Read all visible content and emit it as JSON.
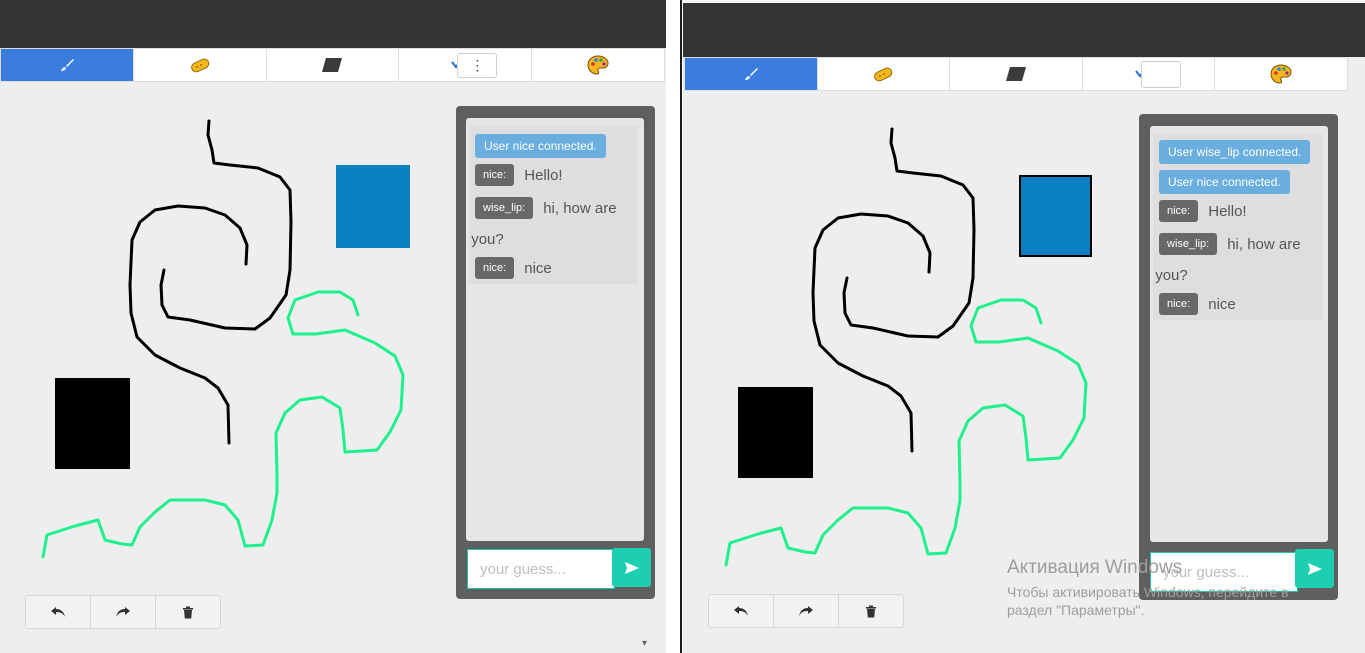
{
  "toolbar": {
    "tools": [
      "brush-icon",
      "eraser-icon",
      "shape-icon",
      "color-dropdown",
      "palette-icon"
    ],
    "more_glyph": "⋮"
  },
  "left_chat": {
    "messages": [
      {
        "type": "system",
        "text": "User nice connected."
      },
      {
        "type": "user",
        "user": "nice:",
        "text": "Hello!"
      },
      {
        "type": "user",
        "user": "wise_lip:",
        "text": "hi, how are you?"
      },
      {
        "type": "user",
        "user": "nice:",
        "text": "nice"
      }
    ],
    "input_placeholder": "your guess..."
  },
  "right_chat": {
    "messages": [
      {
        "type": "system",
        "text": "User wise_lip connected."
      },
      {
        "type": "system",
        "text": "User nice connected."
      },
      {
        "type": "user",
        "user": "nice:",
        "text": "Hello!"
      },
      {
        "type": "user",
        "user": "wise_lip:",
        "text": "hi, how are you?"
      },
      {
        "type": "user",
        "user": "nice:",
        "text": "nice"
      }
    ],
    "input_placeholder": "your guess..."
  },
  "actions": [
    "undo-icon",
    "redo-icon",
    "trash-icon"
  ],
  "watermark": {
    "title": "Активация Windows",
    "line1": "Чтобы активировать Windows, перейдите в",
    "line2": "раздел \"Параметры\"."
  },
  "colors": {
    "active_tool": "#3a7ddc",
    "system_msg": "#6aaedf",
    "user_tag": "#686868",
    "send": "#1dcfb0",
    "stroke_green": "#1ef08c",
    "rect_blue": "#0a7fc2"
  }
}
